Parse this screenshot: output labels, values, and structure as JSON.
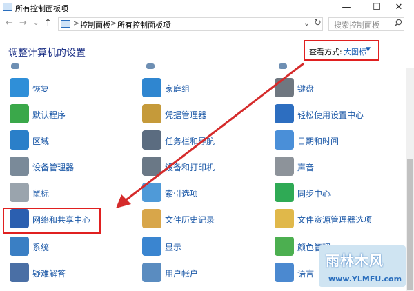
{
  "window": {
    "title": "所有控制面板项",
    "minimize": "—",
    "maximize": "☐",
    "close": "✕"
  },
  "nav": {
    "back": "←",
    "forward": "→",
    "dropdown": "⌄",
    "up": "↑",
    "refresh": "↻"
  },
  "breadcrumb": {
    "sep": ">",
    "items": [
      "控制面板",
      "所有控制面板项"
    ],
    "dropdown": "⌄"
  },
  "search": {
    "placeholder": "搜索控制面板"
  },
  "heading": "调整计算机的设置",
  "view_by": {
    "label": "查看方式:",
    "value": "大图标",
    "caret": "▼"
  },
  "items": {
    "col1": [
      "恢复",
      "默认程序",
      "区域",
      "设备管理器",
      "鼠标",
      "网络和共享中心",
      "系统",
      "疑难解答"
    ],
    "col2": [
      "家庭组",
      "凭据管理器",
      "任务栏和导航",
      "设备和打印机",
      "索引选项",
      "文件历史记录",
      "显示",
      "用户帐户"
    ],
    "col3": [
      "键盘",
      "轻松使用设置中心",
      "日期和时间",
      "声音",
      "同步中心",
      "文件资源管理器选项",
      "颜色管理",
      "语言"
    ]
  },
  "icons": {
    "col1": [
      "recovery-icon",
      "default-programs-icon",
      "region-icon",
      "device-manager-icon",
      "mouse-icon",
      "network-sharing-icon",
      "system-icon",
      "troubleshooting-icon"
    ],
    "col2": [
      "homegroup-icon",
      "credential-manager-icon",
      "taskbar-navigation-icon",
      "devices-printers-icon",
      "indexing-options-icon",
      "file-history-icon",
      "display-icon",
      "user-accounts-icon"
    ],
    "col3": [
      "keyboard-icon",
      "ease-of-access-icon",
      "date-time-icon",
      "sound-icon",
      "sync-center-icon",
      "file-explorer-options-icon",
      "color-management-icon",
      "language-icon"
    ]
  },
  "watermark": {
    "big": "雨林木风",
    "small": "www.YLMFU.com"
  },
  "colors": {
    "link": "#1e5aa8",
    "heading": "#1e3287",
    "highlight": "#e02020"
  }
}
